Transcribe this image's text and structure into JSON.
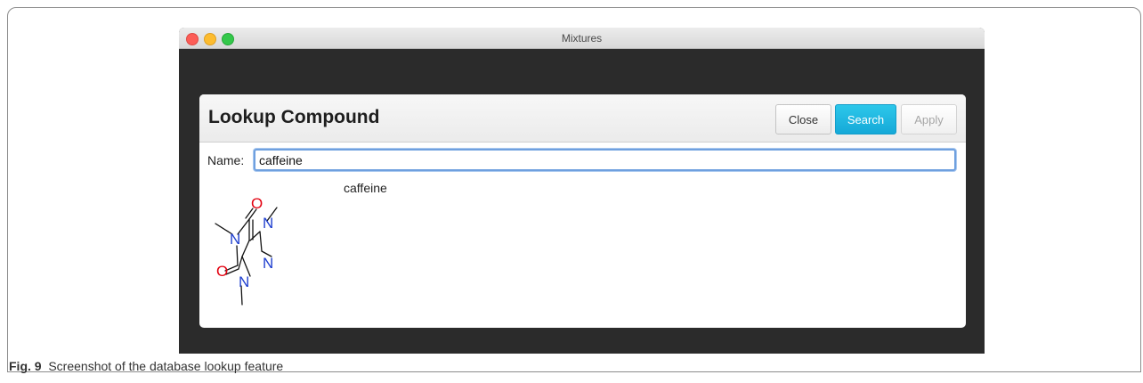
{
  "window": {
    "title": "Mixtures"
  },
  "dialog": {
    "title": "Lookup Compound",
    "buttons": {
      "close": "Close",
      "search": "Search",
      "apply": "Apply"
    },
    "name_label": "Name:",
    "name_value": "caffeine"
  },
  "result": {
    "name": "caffeine",
    "structure": {
      "icon": "caffeine-structure-diagram",
      "atoms": {
        "o_top": "O",
        "o_left": "O",
        "n1": "N",
        "n3": "N",
        "n7": "N",
        "n9": "N"
      }
    }
  },
  "caption": {
    "label": "Fig. 9",
    "text": "Screenshot of the database lookup feature"
  },
  "colors": {
    "search_accent": "#1fb6e2",
    "focus_ring": "#6fa0df",
    "oxygen": "#e3000f",
    "nitrogen": "#1f3fcf"
  }
}
